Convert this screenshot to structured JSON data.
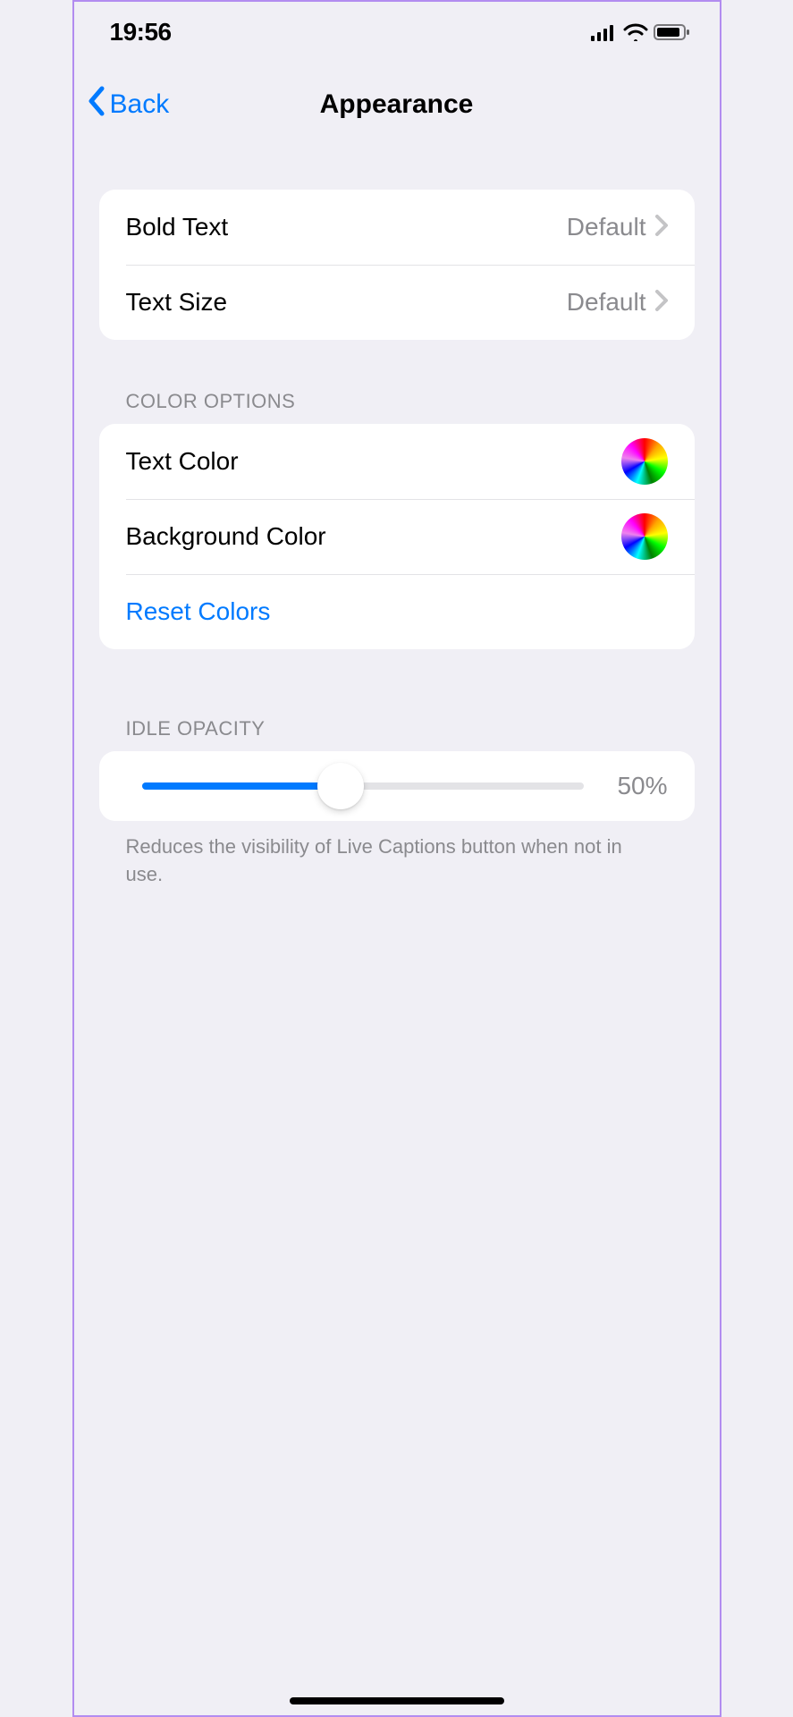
{
  "status": {
    "time": "19:56"
  },
  "nav": {
    "back_label": "Back",
    "title": "Appearance"
  },
  "text_group": {
    "bold_text": {
      "label": "Bold Text",
      "value": "Default"
    },
    "text_size": {
      "label": "Text Size",
      "value": "Default"
    }
  },
  "color_group": {
    "header": "COLOR OPTIONS",
    "text_color": {
      "label": "Text Color"
    },
    "background_color": {
      "label": "Background Color"
    },
    "reset": {
      "label": "Reset Colors"
    }
  },
  "opacity_group": {
    "header": "IDLE OPACITY",
    "value_pct": 50,
    "value_label": "50%",
    "footer": "Reduces the visibility of Live Captions button when not in use."
  },
  "colors": {
    "accent": "#007aff",
    "secondary_text": "#8a8a8e"
  }
}
